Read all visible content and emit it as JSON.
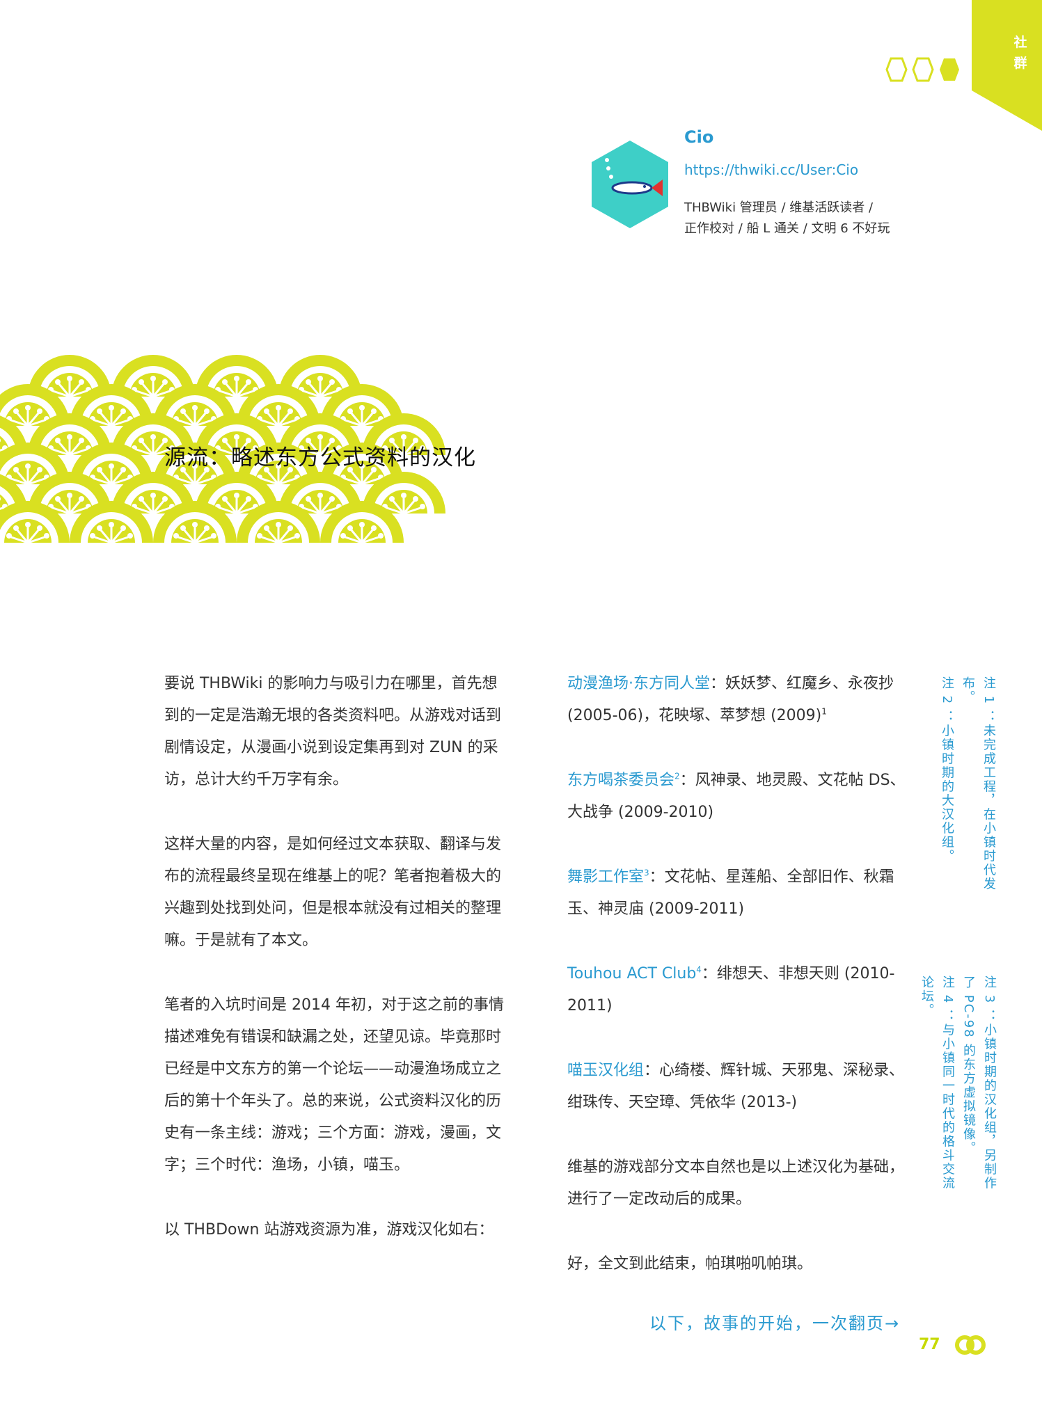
{
  "corner": {
    "label": "社群",
    "accent": "#d9e021"
  },
  "author": {
    "name": "Cio",
    "link": "https://thwiki.cc/User:Cio",
    "desc_line1": "THBWiki 管理员 / 维基活跃读者 /",
    "desc_line2": "正作校对 / 船 L 通关 / 文明 6 不好玩",
    "avatar_color": "#3ecfc7"
  },
  "article": {
    "title": "源流：略述东方公式资料的汉化",
    "left_paragraphs": [
      "要说 THBWiki 的影响力与吸引力在哪里，首先想到的一定是浩瀚无垠的各类资料吧。从游戏对话到剧情设定，从漫画小说到设定集再到对 ZUN 的采访，总计大约千万字有余。",
      "这样大量的内容，是如何经过文本获取、翻译与发布的流程最终呈现在维基上的呢？笔者抱着极大的兴趣到处找到处问，但是根本就没有过相关的整理嘛。于是就有了本文。",
      "笔者的入坑时间是 2014 年初，对于这之前的事情描述难免有错误和缺漏之处，还望见谅。毕竟那时已经是中文东方的第一个论坛——动漫渔场成立之后的第十个年头了。总的来说，公式资料汉化的历史有一条主线：游戏；三个方面：游戏，漫画，文字；三个时代：渔场，小镇，喵玉。",
      "以 THBDown 站游戏资源为准，游戏汉化如右："
    ],
    "groups": [
      {
        "name": "动漫渔场·东方同人堂",
        "sup": "",
        "text": "：妖妖梦、红魔乡、永夜抄 (2005-06)，花映塚、萃梦想 (2009)",
        "trail_sup": "1"
      },
      {
        "name": "东方喝茶委员会",
        "sup": "2",
        "text": "：风神录、地灵殿、文花帖 DS、大战争 (2009-2010)",
        "trail_sup": ""
      },
      {
        "name": "舞影工作室",
        "sup": "3",
        "text": "：文花帖、星莲船、全部旧作、秋霜玉、神灵庙 (2009-2011)",
        "trail_sup": ""
      },
      {
        "name": "Touhou ACT Club",
        "sup": "4",
        "text": "：绯想天、非想天则 (2010-2011)",
        "trail_sup": ""
      },
      {
        "name": "喵玉汉化组",
        "sup": "",
        "text": "：心绮楼、辉针城、天邪鬼、深秘录、绀珠传、天空璋、凭依华 (2013-)",
        "trail_sup": ""
      }
    ],
    "closing1": "维基的游戏部分文本自然也是以上述汉化为基础，进行了一定改动后的成果。",
    "closing2": "好，全文到此结束，帕琪啪叽帕琪。"
  },
  "notes": {
    "n1": "注 1 ：未完成工程，在小镇时代发布。",
    "n2": "注 2 ：小镇时期的大汉化组。",
    "n3": "注 3 ：小镇时期的汉化组，另制作了 PC-98 的东方虚拟镜像。",
    "n4": "注 4 ：与小镇同一时代的格斗交流论坛。"
  },
  "footer": {
    "turn_page": "以下，故事的开始，一次翻页→",
    "page_number": "77"
  }
}
